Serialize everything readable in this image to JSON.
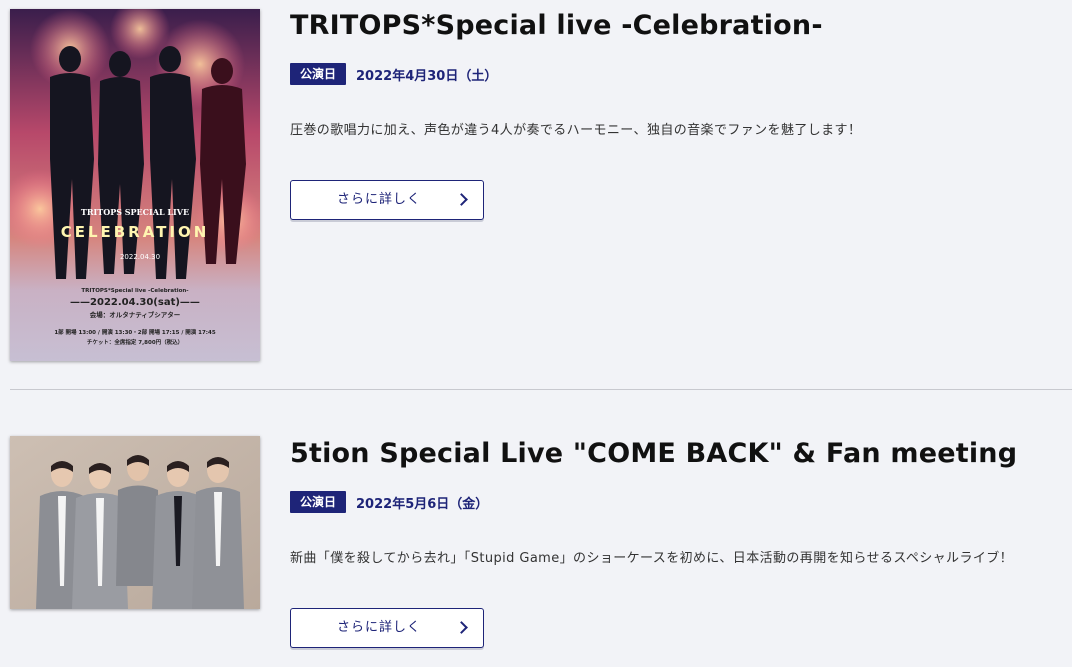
{
  "events": [
    {
      "title": "TRITOPS*Special live -Celebration-",
      "badge": "公演日",
      "date": "2022年4月30日（土）",
      "description": "圧巻の歌唱力に加え、声色が違う4人が奏でるハーモニー、独自の音楽でファンを魅了します！",
      "button_label": "さらに詳しく",
      "poster": {
        "script_title": "TRITOPS SPECIAL LIVE",
        "big_title": "CELEBRATION",
        "small_date": "2022.04.30",
        "sub": "TRITOPS*Special live -Celebration-",
        "date_line": "——2022.04.30(sat)——",
        "venue": "会場：オルタナティブシアター",
        "times": "1部 開場 13:00 / 開演 13:30・2部 開場 17:15 / 開演 17:45",
        "ticket": "チケット：全席指定 7,800円（税込）"
      }
    },
    {
      "title": "5tion Special Live \"COME BACK\" & Fan meeting",
      "badge": "公演日",
      "date": "2022年5月6日（金）",
      "description": "新曲「僕を殺してから去れ」「Stupid Game」のショーケースを初めに、日本活動の再開を知らせるスペシャルライブ！",
      "button_label": "さらに詳しく"
    }
  ],
  "colors": {
    "accent": "#1e2478",
    "background": "#f2f3f7"
  }
}
